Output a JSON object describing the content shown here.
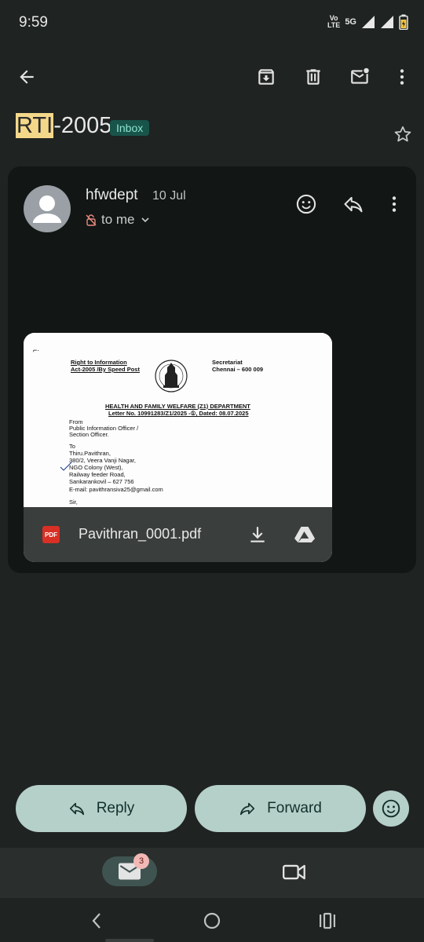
{
  "status": {
    "time": "9:59",
    "volte_line1": "Vo",
    "volte_line2": "LTE",
    "network": "5G"
  },
  "toolbar": {
    "back_icon": "arrow-back-icon",
    "archive_icon": "archive-icon",
    "delete_icon": "trash-icon",
    "mark_unread_icon": "mark-unread-icon",
    "more_icon": "more-vert-icon"
  },
  "email": {
    "subject_highlight": "RTI",
    "subject_rest": "-2005",
    "label": "Inbox",
    "sender": "hfwdept",
    "date": "10 Jul",
    "recipient": "to me"
  },
  "attachment": {
    "filename": "Pavithran_0001.pdf",
    "type_label": "PDF",
    "preview": {
      "left_title_1": "Right to Information",
      "left_title_2": "Act-2005 /By Speed Post",
      "right_title_1": "Secretariat",
      "right_title_2": "Chennai – 600 009",
      "dept": "HEALTH AND FAMILY WELFARE (Z1) DEPARTMENT",
      "letter_no": "Letter No. 10991283/Z1/2025 -①, Dated: 08.07.2025",
      "from_1": "From",
      "from_2": "Public Information Officer /",
      "from_3": "Section Officer.",
      "to_1": "To",
      "to_2": "Thiru.Pavithran,",
      "to_3": "380/2, Veera Vanji Nagar,",
      "to_4": "NGO Colony (West),",
      "to_5": "Railway feeder Road,",
      "to_6": "Sankarankovil – 627 756",
      "to_7": "E-mail: pavithransiva25@gmail.com",
      "salutation": "Sir,"
    }
  },
  "actions": {
    "reply": "Reply",
    "forward": "Forward"
  },
  "bottom_nav": {
    "mail_badge": "3"
  },
  "colors": {
    "background": "#1f2322",
    "card": "#121615",
    "pill": "#b5cfc9",
    "chip": "#18544a",
    "highlight": "#f4d88a"
  }
}
